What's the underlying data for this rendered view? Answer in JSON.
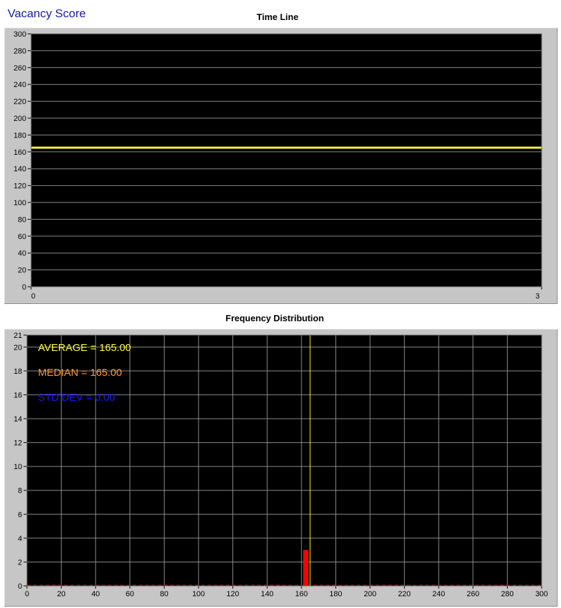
{
  "app": {
    "title": "Vacancy Score"
  },
  "colors": {
    "plot_bg": "#000000",
    "grid": "#8c8c8c",
    "timeline_line": "#ffff33",
    "histogram_bar": "#ff0000",
    "average_line": "#ffff00",
    "average_text": "#ffff40",
    "median_text": "#ff9933",
    "std_text": "#1a1aff",
    "frame": "#c6c6c6"
  },
  "chart_data": [
    {
      "type": "line",
      "title": "Time Line",
      "xlabel": "",
      "ylabel": "",
      "xlim": [
        0,
        3
      ],
      "ylim": [
        0,
        300
      ],
      "x_ticks": [
        "0",
        "3"
      ],
      "y_ticks": [
        "0",
        "20",
        "40",
        "60",
        "80",
        "100",
        "120",
        "140",
        "160",
        "180",
        "200",
        "220",
        "240",
        "260",
        "280",
        "300"
      ],
      "grid": true,
      "series": [
        {
          "x": [
            0,
            3
          ],
          "values": [
            165,
            165
          ]
        }
      ]
    },
    {
      "type": "bar",
      "title": "Frequency Distribution",
      "xlabel": "",
      "ylabel": "",
      "xlim": [
        0,
        300
      ],
      "ylim": [
        0,
        21
      ],
      "x_ticks": [
        "0",
        "20",
        "40",
        "60",
        "80",
        "100",
        "120",
        "140",
        "160",
        "180",
        "200",
        "220",
        "240",
        "260",
        "280",
        "300"
      ],
      "y_ticks": [
        "0",
        "2",
        "4",
        "6",
        "8",
        "10",
        "12",
        "14",
        "16",
        "18",
        "20",
        "21"
      ],
      "grid": true,
      "bars": [
        {
          "x_start": 161,
          "x_end": 164,
          "value": 3
        }
      ],
      "average_line_x": 165,
      "annotations": {
        "average": "AVERAGE = 165.00",
        "median": "MEDIAN = 165.00",
        "std_dev": "STD DEV = 0.00"
      }
    }
  ]
}
